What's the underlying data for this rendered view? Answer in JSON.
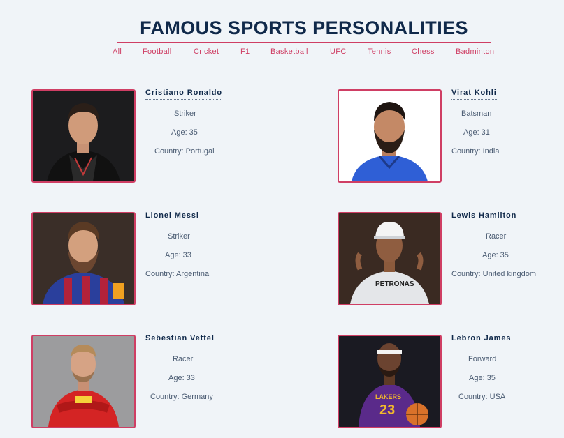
{
  "page": {
    "title": "FAMOUS SPORTS PERSONALITIES",
    "accent_color": "#cf3e64",
    "title_color": "#10294a"
  },
  "filters": [
    "All",
    "Football",
    "Cricket",
    "F1",
    "Basketball",
    "UFC",
    "Tennis",
    "Chess",
    "Badminton"
  ],
  "athletes": [
    {
      "name": "Cristiano Ronaldo",
      "role": "Striker",
      "age": "Age: 35",
      "country": "Country: Portugal",
      "photo": "athlete-photo-ronaldo"
    },
    {
      "name": "Virat Kohli",
      "role": "Batsman",
      "age": "Age: 31",
      "country": "Country: India",
      "photo": "athlete-photo-kohli"
    },
    {
      "name": "Lionel Messi",
      "role": "Striker",
      "age": "Age: 33",
      "country": "Country: Argentina",
      "photo": "athlete-photo-messi"
    },
    {
      "name": "Lewis Hamilton",
      "role": "Racer",
      "age": "Age: 35",
      "country": "Country: United kingdom",
      "photo": "athlete-photo-hamilton"
    },
    {
      "name": "Sebestian Vettel",
      "role": "Racer",
      "age": "Age: 33",
      "country": "Country: Germany",
      "photo": "athlete-photo-vettel"
    },
    {
      "name": "Lebron James",
      "role": "Forward",
      "age": "Age: 35",
      "country": "Country: USA",
      "photo": "athlete-photo-james"
    }
  ]
}
